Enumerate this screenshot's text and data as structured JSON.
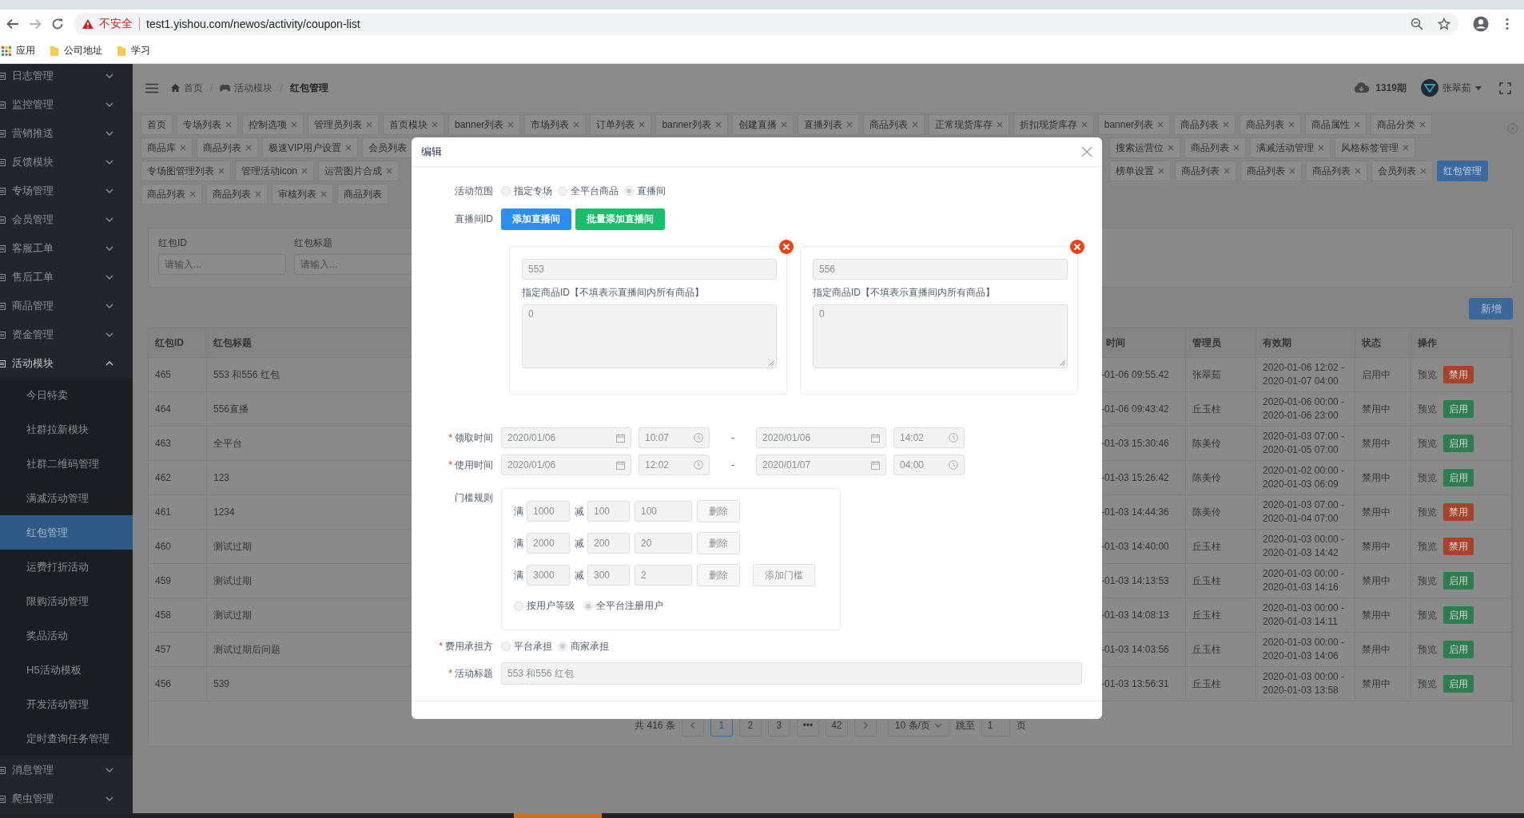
{
  "browser": {
    "not_secure": "不安全",
    "url": "test1.yishou.com/newos/activity/coupon-list",
    "bookmarks": [
      {
        "label": "应用",
        "kind": "apps"
      },
      {
        "label": "公司地址",
        "kind": "folder"
      },
      {
        "label": "学习",
        "kind": "folder"
      }
    ]
  },
  "sidebar": {
    "items": [
      {
        "label": "日志管理",
        "expanded": false
      },
      {
        "label": "监控管理",
        "expanded": false
      },
      {
        "label": "营销推送",
        "expanded": false
      },
      {
        "label": "反馈模块",
        "expanded": false
      },
      {
        "label": "专场管理",
        "expanded": false
      },
      {
        "label": "会员管理",
        "expanded": false
      },
      {
        "label": "客服工单",
        "expanded": false
      },
      {
        "label": "售后工单",
        "expanded": false
      },
      {
        "label": "商品管理",
        "expanded": false
      },
      {
        "label": "资金管理",
        "expanded": false
      },
      {
        "label": "活动模块",
        "expanded": true,
        "children": [
          {
            "label": "今日特卖",
            "selected": false
          },
          {
            "label": "社群拉新模块",
            "selected": false
          },
          {
            "label": "社群二维码管理",
            "selected": false
          },
          {
            "label": "满减活动管理",
            "selected": false
          },
          {
            "label": "红包管理",
            "selected": true
          },
          {
            "label": "运费打折活动",
            "selected": false
          },
          {
            "label": "限购活动管理",
            "selected": false
          },
          {
            "label": "奖品活动",
            "selected": false
          },
          {
            "label": "H5活动模板",
            "selected": false
          },
          {
            "label": "开发活动管理",
            "selected": false
          },
          {
            "label": "定时查询任务管理",
            "selected": false
          }
        ]
      },
      {
        "label": "消息管理",
        "expanded": false
      },
      {
        "label": "爬虫管理",
        "expanded": false
      }
    ]
  },
  "header": {
    "separator": "/",
    "breadcrumb": [
      {
        "label": "首页",
        "kind": "home"
      },
      {
        "label": "活动模块",
        "kind": "module"
      },
      {
        "label": "红包管理",
        "kind": "current"
      }
    ],
    "issue": "1319期",
    "user": "张翠茹"
  },
  "tags": {
    "rows": [
      {
        "left": [
          {
            "label": "首页",
            "closable": false,
            "selected": false
          },
          {
            "label": "专场列表",
            "closable": true,
            "selected": false
          },
          {
            "label": "控制选项",
            "closable": true,
            "selected": false
          },
          {
            "label": "管理员列表",
            "closable": true,
            "selected": false
          },
          {
            "label": "首页模块",
            "closable": true,
            "selected": false
          },
          {
            "label": "banner列表",
            "closable": true,
            "selected": false
          },
          {
            "label": "市场列表",
            "closable": true,
            "selected": false
          },
          {
            "label": "订单列表",
            "closable": true,
            "selected": false
          },
          {
            "label": "banner列表",
            "closable": true,
            "selected": false
          },
          {
            "label": "创建直播",
            "closable": true,
            "selected": false
          },
          {
            "label": "直播列表",
            "closable": true,
            "selected": false
          },
          {
            "label": "商品列表",
            "closable": true,
            "selected": false
          },
          {
            "label": "正常现货库存",
            "closable": true,
            "selected": false
          },
          {
            "label": "折扣现货库存",
            "closable": true,
            "selected": false
          },
          {
            "label": "banner列表",
            "closable": true,
            "selected": false
          },
          {
            "label": "商品列表",
            "closable": true,
            "selected": false
          },
          {
            "label": "商品列表",
            "closable": true,
            "selected": false
          },
          {
            "label": "商品属性",
            "closable": true,
            "selected": false
          },
          {
            "label": "商品分类",
            "closable": true,
            "selected": false
          }
        ]
      },
      {
        "left": [
          {
            "label": "商品库",
            "closable": true,
            "selected": false
          },
          {
            "label": "商品列表",
            "closable": true,
            "selected": false
          },
          {
            "label": "极速VIP用户设置",
            "closable": true,
            "selected": false
          },
          {
            "label": "会员列表",
            "closable": false,
            "selected": false
          }
        ],
        "right": [
          {
            "label": "搜索运营位",
            "closable": true,
            "selected": false
          },
          {
            "label": "商品列表",
            "closable": true,
            "selected": false
          },
          {
            "label": "满减活动管理",
            "closable": true,
            "selected": false
          },
          {
            "label": "风格标签管理",
            "closable": true,
            "selected": false
          }
        ]
      },
      {
        "left": [
          {
            "label": "专场图管理列表",
            "closable": true,
            "selected": false
          },
          {
            "label": "管理活动icon",
            "closable": true,
            "selected": false
          },
          {
            "label": "运营图片合成",
            "closable": true,
            "selected": false
          }
        ],
        "right": [
          {
            "label": "榜单设置",
            "closable": true,
            "selected": false
          },
          {
            "label": "商品列表",
            "closable": true,
            "selected": false
          },
          {
            "label": "商品列表",
            "closable": true,
            "selected": false
          },
          {
            "label": "商品列表",
            "closable": true,
            "selected": false
          },
          {
            "label": "会员列表",
            "closable": true,
            "selected": false
          },
          {
            "label": "红包管理",
            "closable": false,
            "selected": true
          }
        ]
      },
      {
        "left": [
          {
            "label": "商品列表",
            "closable": true,
            "selected": false
          },
          {
            "label": "商品列表",
            "closable": true,
            "selected": false
          },
          {
            "label": "审核列表",
            "closable": true,
            "selected": false
          },
          {
            "label": "商品列表",
            "closable": false,
            "selected": false
          }
        ]
      }
    ]
  },
  "filter": {
    "fields": [
      {
        "label": "红包ID",
        "placeholder": "请输入..."
      },
      {
        "label": "红包标题",
        "placeholder": "请输入..."
      }
    ]
  },
  "new_button": "新增",
  "table": {
    "columns": [
      "红包ID",
      "红包标题",
      "时间",
      "管理员",
      "有效期",
      "状态",
      "操作"
    ],
    "rows": [
      {
        "id": "465",
        "title": "553 和556 红包",
        "time": "-01-06 09:55:42",
        "admin": "张翠茹",
        "validity": "2020-01-06 12:02 - 2020-01-07 04:00",
        "status": "启用中",
        "preview": "预览",
        "action": {
          "label": "禁用",
          "kind": "disable"
        }
      },
      {
        "id": "464",
        "title": "556直播",
        "time": "-01-06 09:43:42",
        "admin": "丘玉柱",
        "validity": "2020-01-06 00:00 - 2020-01-06 23:00",
        "status": "禁用中",
        "preview": "预览",
        "action": {
          "label": "启用",
          "kind": "enable"
        }
      },
      {
        "id": "463",
        "title": "全平台",
        "time": "-01-03 15:30:46",
        "admin": "陈美伶",
        "validity": "2020-01-03 07:00 - 2020-01-05 07:00",
        "status": "禁用中",
        "preview": "预览",
        "action": {
          "label": "启用",
          "kind": "enable"
        }
      },
      {
        "id": "462",
        "title": "123",
        "time": "-01-03 15:26:42",
        "admin": "陈美伶",
        "validity": "2020-01-02 00:00 - 2020-01-03 06:09",
        "status": "禁用中",
        "preview": "预览",
        "action": {
          "label": "启用",
          "kind": "enable"
        }
      },
      {
        "id": "461",
        "title": "1234",
        "time": "-01-03 14:44:36",
        "admin": "陈美伶",
        "validity": "2020-01-03 07:00 - 2020-01-04 07:00",
        "status": "禁用中",
        "preview": "预览",
        "action": {
          "label": "禁用",
          "kind": "disable"
        }
      },
      {
        "id": "460",
        "title": "测试过期",
        "time": "-01-03 14:40:00",
        "admin": "丘玉柱",
        "validity": "2020-01-03 00:00 - 2020-01-03 14:42",
        "status": "禁用中",
        "preview": "预览",
        "action": {
          "label": "禁用",
          "kind": "disable"
        }
      },
      {
        "id": "459",
        "title": "测试过期",
        "time": "-01-03 14:13:53",
        "admin": "丘玉柱",
        "validity": "2020-01-03 00:00 - 2020-01-03 14:16",
        "status": "禁用中",
        "preview": "预览",
        "action": {
          "label": "启用",
          "kind": "enable"
        }
      },
      {
        "id": "458",
        "title": "测试过期",
        "time": "-01-03 14:08:13",
        "admin": "丘玉柱",
        "validity": "2020-01-03 00:00 - 2020-01-03 14:11",
        "status": "禁用中",
        "preview": "预览",
        "action": {
          "label": "启用",
          "kind": "enable"
        }
      },
      {
        "id": "457",
        "title": "测试过期后问题",
        "time": "-01-03 14:03:56",
        "admin": "丘玉柱",
        "validity": "2020-01-03 00:00 - 2020-01-03 14:06",
        "status": "禁用中",
        "preview": "预览",
        "action": {
          "label": "启用",
          "kind": "enable"
        }
      },
      {
        "id": "456",
        "title": "539",
        "time": "-01-03 13:56:31",
        "admin": "丘玉柱",
        "validity": "2020-01-03 00:00 - 2020-01-03 13:58",
        "status": "禁用中",
        "preview": "预览",
        "action": {
          "label": "启用",
          "kind": "enable"
        }
      }
    ]
  },
  "pagination": {
    "total": "共 416 条",
    "pages": [
      {
        "label": "1",
        "selected": true
      },
      {
        "label": "2",
        "selected": false
      },
      {
        "label": "3",
        "selected": false
      },
      {
        "label": "•••",
        "selected": false
      },
      {
        "label": "42",
        "selected": false
      }
    ],
    "page_size": "10 条/页",
    "jump_label": "跳至",
    "jump_value": "1",
    "jump_suffix": "页"
  },
  "modal": {
    "title": "编辑",
    "required_mark": "*",
    "scope": {
      "label": "活动范围",
      "required": false,
      "options": [
        {
          "label": "指定专场",
          "selected": false
        },
        {
          "label": "全平台商品",
          "selected": false
        },
        {
          "label": "直播间",
          "selected": true
        }
      ]
    },
    "live_room": {
      "label": "直播间ID",
      "required": false,
      "buttons": [
        {
          "label": "添加直播间",
          "kind": "primary"
        },
        {
          "label": "批量添加直播间",
          "kind": "success"
        }
      ],
      "rooms": [
        {
          "id": "553",
          "goods_label": "指定商品ID【不填表示直播间内所有商品】",
          "goods": "0"
        },
        {
          "id": "556",
          "goods_label": "指定商品ID【不填表示直播间内所有商品】",
          "goods": "0"
        }
      ]
    },
    "times": [
      {
        "label": "领取时间",
        "required": true,
        "start_date": "2020/01/06",
        "start_time": "10:07",
        "separator": "-",
        "end_date": "2020/01/06",
        "end_time": "14:02"
      },
      {
        "label": "使用时间",
        "required": true,
        "start_date": "2020/01/06",
        "start_time": "12:02",
        "separator": "-",
        "end_date": "2020/01/07",
        "end_time": "04:00"
      }
    ],
    "threshold": {
      "label": "门槛规则",
      "required": false,
      "rules": [
        {
          "full_label": "满",
          "full": "1000",
          "minus_label": "减",
          "minus": "100",
          "count": "100",
          "delete": "删除"
        },
        {
          "full_label": "满",
          "full": "2000",
          "minus_label": "减",
          "minus": "200",
          "count": "20",
          "delete": "删除"
        },
        {
          "full_label": "满",
          "full": "3000",
          "minus_label": "减",
          "minus": "300",
          "count": "2",
          "delete": "删除"
        }
      ],
      "add_button": "添加门槛",
      "audience": [
        {
          "label": "按用户等级",
          "selected": false
        },
        {
          "label": "全平台注册用户",
          "selected": true
        }
      ]
    },
    "cost": {
      "label": "费用承担方",
      "required": true,
      "options": [
        {
          "label": "平台承担",
          "selected": false
        },
        {
          "label": "商家承担",
          "selected": true
        }
      ]
    },
    "title_field": {
      "label": "活动标题",
      "required": true,
      "value": "553 和556 红包"
    }
  }
}
